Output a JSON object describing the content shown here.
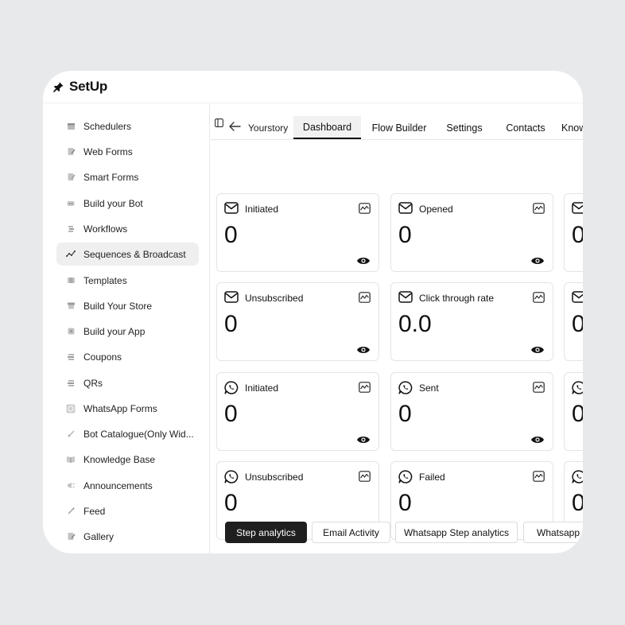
{
  "app": {
    "title": "SetUp"
  },
  "sidebar": {
    "items": [
      {
        "label": "Schedulers",
        "icon": "calendar-icon"
      },
      {
        "label": "Web Forms",
        "icon": "form-icon"
      },
      {
        "label": "Smart Forms",
        "icon": "smart-form-icon"
      },
      {
        "label": "Build your Bot",
        "icon": "bot-icon"
      },
      {
        "label": "Workflows",
        "icon": "workflow-icon"
      },
      {
        "label": "Sequences & Broadcast",
        "icon": "sequence-icon",
        "active": true
      },
      {
        "label": "Templates",
        "icon": "template-icon"
      },
      {
        "label": "Build Your Store",
        "icon": "store-icon"
      },
      {
        "label": "Build your App",
        "icon": "app-icon"
      },
      {
        "label": "Coupons",
        "icon": "coupon-icon"
      },
      {
        "label": "QRs",
        "icon": "qr-icon"
      },
      {
        "label": "WhatsApp Forms",
        "icon": "whatsapp-form-icon"
      },
      {
        "label": "Bot Catalogue(Only Wid...",
        "icon": "catalogue-icon"
      },
      {
        "label": "Knowledge Base",
        "icon": "book-icon"
      },
      {
        "label": "Announcements",
        "icon": "megaphone-icon"
      },
      {
        "label": "Feed",
        "icon": "feed-icon"
      },
      {
        "label": "Gallery",
        "icon": "gallery-icon"
      }
    ]
  },
  "header": {
    "breadcrumb": "Yourstory",
    "tabs": [
      "Dashboard",
      "Flow Builder",
      "Settings",
      "Contacts",
      "Know"
    ],
    "active_tab": "Dashboard"
  },
  "cards": [
    {
      "title": "Initiated",
      "value": "0",
      "icon": "mail-icon"
    },
    {
      "title": "Opened",
      "value": "0",
      "icon": "mail-icon"
    },
    {
      "title": "",
      "value": "0",
      "icon": "mail-icon"
    },
    {
      "title": "Unsubscribed",
      "value": "0",
      "icon": "mail-icon"
    },
    {
      "title": "Click through rate",
      "value": "0.0",
      "icon": "mail-icon"
    },
    {
      "title": "",
      "value": "0",
      "icon": "mail-icon"
    },
    {
      "title": "Initiated",
      "value": "0",
      "icon": "whatsapp-icon"
    },
    {
      "title": "Sent",
      "value": "0",
      "icon": "whatsapp-icon"
    },
    {
      "title": "",
      "value": "0",
      "icon": "whatsapp-icon"
    },
    {
      "title": "Unsubscribed",
      "value": "0",
      "icon": "whatsapp-icon"
    },
    {
      "title": "Failed",
      "value": "0",
      "icon": "whatsapp-icon"
    },
    {
      "title": "",
      "value": "0",
      "icon": "whatsapp-icon"
    }
  ],
  "bottom_tabs": [
    "Step analytics",
    "Email Activity",
    "Whatsapp Step analytics",
    "Whatsapp A"
  ],
  "active_bottom_tab": "Step analytics"
}
